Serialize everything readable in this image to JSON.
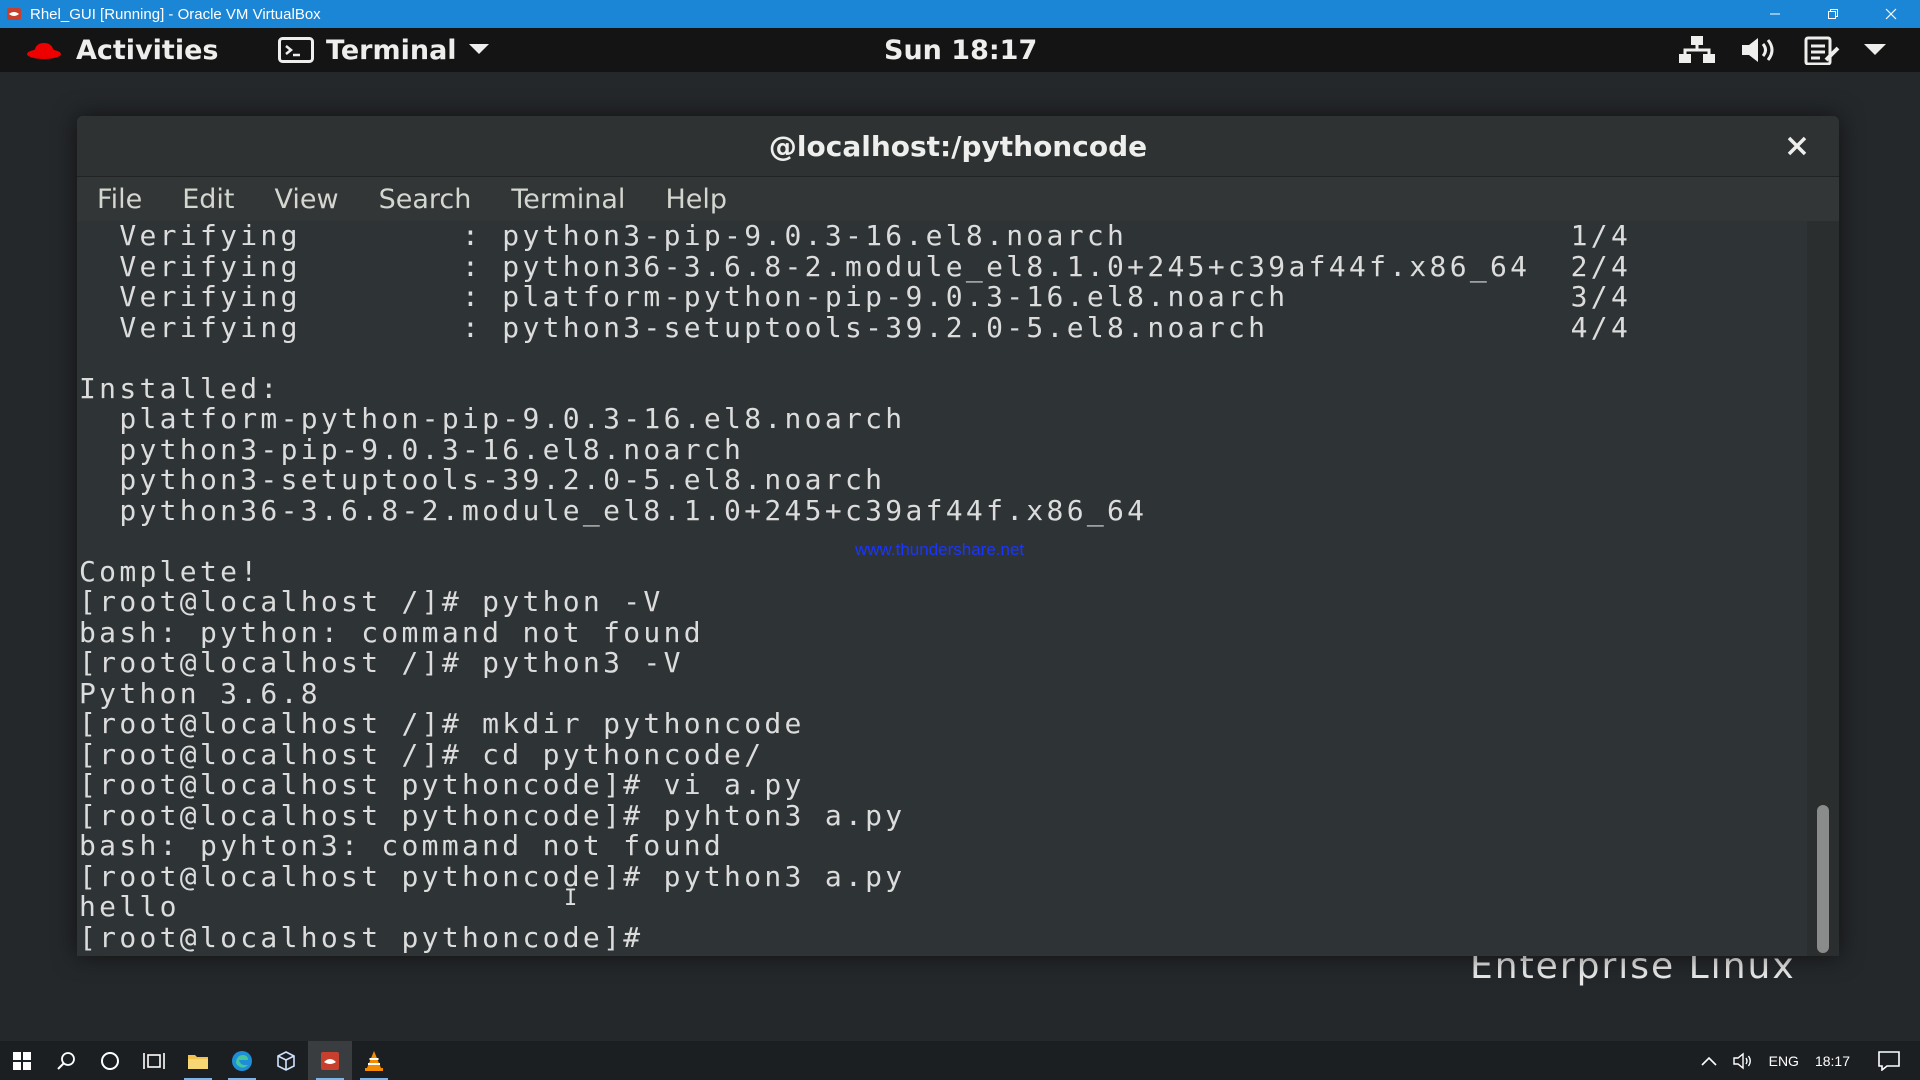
{
  "vbox": {
    "title": "Rhel_GUI [Running] - Oracle VM VirtualBox"
  },
  "gnome": {
    "activities_label": "Activities",
    "app_menu_label": "Terminal",
    "clock": "Sun 18:17"
  },
  "terminal": {
    "title": "@localhost:/pythoncode",
    "menu": [
      "File",
      "Edit",
      "View",
      "Search",
      "Terminal",
      "Help"
    ],
    "output": "  Verifying        : python3-pip-9.0.3-16.el8.noarch                      1/4\n  Verifying        : python36-3.6.8-2.module_el8.1.0+245+c39af44f.x86_64  2/4\n  Verifying        : platform-python-pip-9.0.3-16.el8.noarch              3/4\n  Verifying        : python3-setuptools-39.2.0-5.el8.noarch               4/4\n\nInstalled:\n  platform-python-pip-9.0.3-16.el8.noarch\n  python3-pip-9.0.3-16.el8.noarch\n  python3-setuptools-39.2.0-5.el8.noarch\n  python36-3.6.8-2.module_el8.1.0+245+c39af44f.x86_64\n\nComplete!\n[root@localhost /]# python -V\nbash: python: command not found\n[root@localhost /]# python3 -V\nPython 3.6.8\n[root@localhost /]# mkdir pythoncode\n[root@localhost /]# cd pythoncode/\n[root@localhost pythoncode]# vi a.py\n[root@localhost pythoncode]# pyhton3 a.py\nbash: pyhton3: command not found\n[root@localhost pythoncode]# python3 a.py\nhello\n[root@localhost pythoncode]# ",
    "watermark": "www.thundershare.net"
  },
  "desktop": {
    "brand_text": "Enterprise Linux"
  },
  "taskbar": {
    "language": "ENG",
    "time": "18:17"
  },
  "colors": {
    "vbox_blue": "#1b86d6",
    "terminal_bg": "#2e3436",
    "topbar_bg": "#141414"
  }
}
